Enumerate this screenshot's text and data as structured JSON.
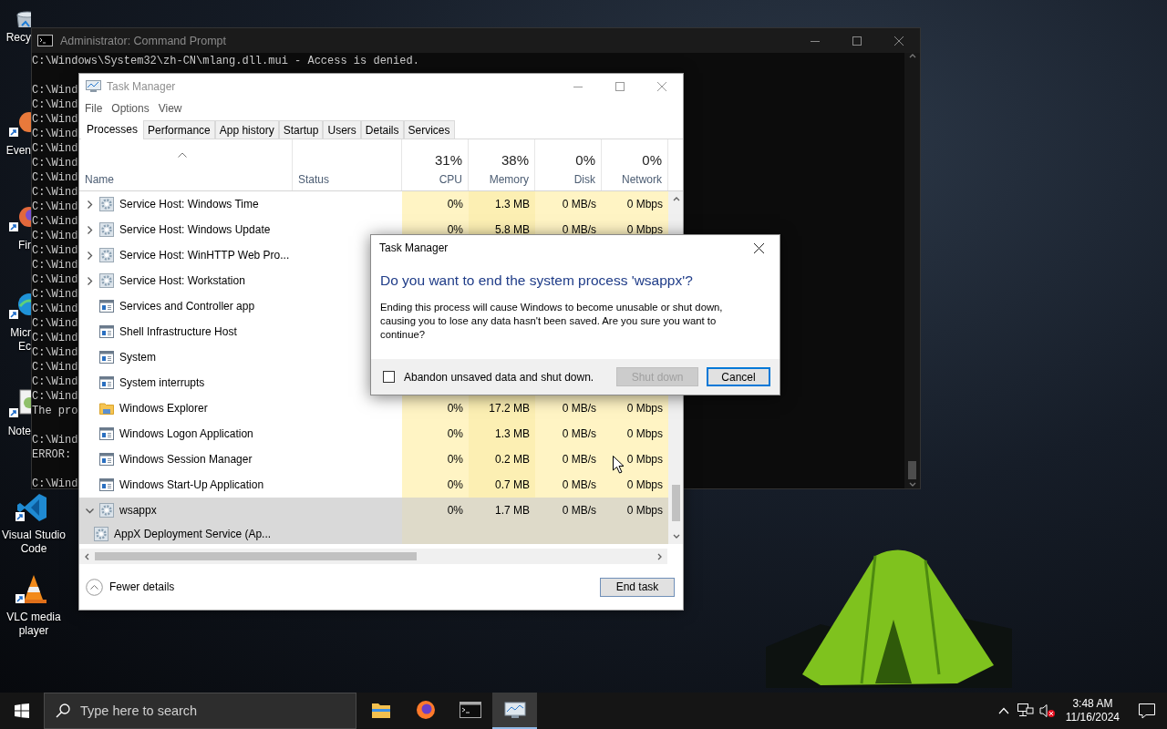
{
  "desktop_icons": [
    {
      "lines": [
        "Recy"
      ],
      "kind": "covered"
    },
    {
      "lines": [
        "Even"
      ],
      "kind": "covered"
    },
    {
      "lines": [
        "Fir"
      ],
      "kind": "covered"
    },
    {
      "lines": [
        "Micr",
        "Ec"
      ],
      "kind": "covered"
    },
    {
      "lines": [
        "Note"
      ],
      "kind": "covered"
    },
    {
      "lines": [
        "Visual Studio",
        "Code"
      ],
      "kind": "full"
    },
    {
      "lines": [
        "VLC media",
        "player"
      ],
      "kind": "full"
    }
  ],
  "command_prompt": {
    "title": "Administrator: Command Prompt",
    "blocks": [
      [
        "C:\\Windows\\System32\\zh-CN\\mlang.dll.mui - Access is denied."
      ],
      [
        "C:\\Wind",
        "C:\\Wind",
        "C:\\Wind",
        "C:\\Wind",
        "C:\\Wind",
        "C:\\Wind",
        "C:\\Wind",
        "C:\\Wind",
        "C:\\Wind",
        "C:\\Wind",
        "C:\\Wind",
        "C:\\Wind",
        "C:\\Wind",
        "C:\\Wind",
        "C:\\Wind",
        "C:\\Wind",
        "C:\\Wind",
        "C:\\Wind",
        "C:\\Wind",
        "C:\\Wind",
        "C:\\Wind",
        "C:\\Wind",
        "The pro"
      ],
      [
        "C:\\Wind",
        "ERROR:"
      ],
      [
        "C:\\Wind"
      ]
    ]
  },
  "task_manager": {
    "title": "Task Manager",
    "menu": [
      "File",
      "Options",
      "View"
    ],
    "tabs": [
      {
        "label": "Processes",
        "selected": true
      },
      {
        "label": "Performance",
        "selected": false
      },
      {
        "label": "App history",
        "selected": false
      },
      {
        "label": "Startup",
        "selected": false
      },
      {
        "label": "Users",
        "selected": false
      },
      {
        "label": "Details",
        "selected": false
      },
      {
        "label": "Services",
        "selected": false
      }
    ],
    "columns": {
      "name": "Name",
      "status": "Status",
      "metrics": [
        {
          "percent": "31%",
          "label": "CPU"
        },
        {
          "percent": "38%",
          "label": "Memory"
        },
        {
          "percent": "0%",
          "label": "Disk"
        },
        {
          "percent": "0%",
          "label": "Network"
        }
      ]
    },
    "rows": [
      {
        "name": "Service Host: Windows Time",
        "kind": "service",
        "expanded": false,
        "selected": false,
        "values": [
          "0%",
          "1.3 MB",
          "0 MB/s",
          "0 Mbps"
        ]
      },
      {
        "name": "Service Host: Windows Update",
        "kind": "service",
        "expanded": false,
        "selected": false,
        "values": [
          "0%",
          "5.8 MB",
          "0 MB/s",
          "0 Mbps"
        ]
      },
      {
        "name": "Service Host: WinHTTP Web Pro...",
        "kind": "service",
        "expanded": false,
        "selected": false
      },
      {
        "name": "Service Host: Workstation",
        "kind": "service",
        "expanded": false,
        "selected": false
      },
      {
        "name": "Services and Controller app",
        "kind": "app",
        "selected": false
      },
      {
        "name": "Shell Infrastructure Host",
        "kind": "app",
        "selected": false
      },
      {
        "name": "System",
        "kind": "app",
        "selected": false
      },
      {
        "name": "System interrupts",
        "kind": "app",
        "selected": false
      },
      {
        "name": "Windows Explorer",
        "kind": "explorer",
        "selected": false,
        "values": [
          "0%",
          "17.2 MB",
          "0 MB/s",
          "0 Mbps"
        ]
      },
      {
        "name": "Windows Logon Application",
        "kind": "app",
        "selected": false,
        "values": [
          "0%",
          "1.3 MB",
          "0 MB/s",
          "0 Mbps"
        ]
      },
      {
        "name": "Windows Session Manager",
        "kind": "app",
        "selected": false,
        "values": [
          "0%",
          "0.2 MB",
          "0 MB/s",
          "0 Mbps"
        ]
      },
      {
        "name": "Windows Start-Up Application",
        "kind": "app",
        "selected": false,
        "values": [
          "0%",
          "0.7 MB",
          "0 MB/s",
          "0 Mbps"
        ]
      },
      {
        "name": "wsappx",
        "kind": "service",
        "expanded": true,
        "selected": true,
        "values": [
          "0%",
          "1.7 MB",
          "0 MB/s",
          "0 Mbps"
        ],
        "children": [
          {
            "name": "AppX Deployment Service (Ap...",
            "kind": "service"
          }
        ]
      }
    ],
    "footer": {
      "toggle": "Fewer details",
      "button": "End task"
    }
  },
  "dialog": {
    "title": "Task Manager",
    "heading": "Do you want to end the system process 'wsappx'?",
    "body": "Ending this process will cause Windows to become unusable or shut down, causing you to lose any data hasn't been saved. Are you sure you want to continue?",
    "checkbox": {
      "label": "Abandon unsaved data and shut down.",
      "checked": false
    },
    "buttons": [
      {
        "label": "Shut down",
        "disabled": true,
        "default": false
      },
      {
        "label": "Cancel",
        "disabled": false,
        "default": true
      }
    ]
  },
  "taskbar": {
    "search_placeholder": "Type here to search",
    "apps": [
      {
        "selected": false
      },
      {
        "selected": false
      },
      {
        "selected": false
      },
      {
        "selected": true
      }
    ],
    "time": "3:48 AM",
    "date": "11/16/2024"
  }
}
